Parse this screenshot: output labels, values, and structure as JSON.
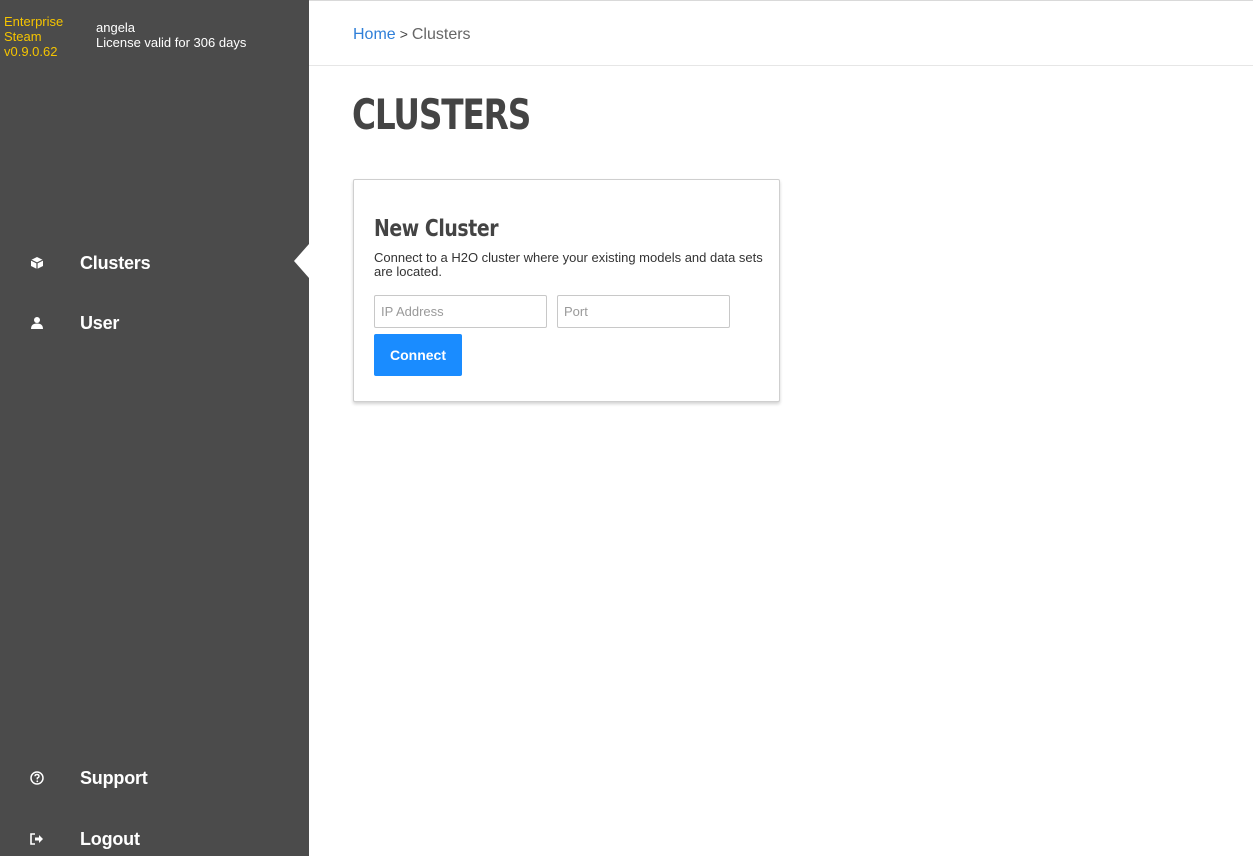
{
  "brand": {
    "line1": "Enterprise",
    "line2": "Steam",
    "version": "v0.9.0.62",
    "color": "#f5c400"
  },
  "user": {
    "name": "angela",
    "license": "License valid for 306 days"
  },
  "sidebar": {
    "items": [
      {
        "label": "Clusters",
        "icon": "cube-icon",
        "active": true
      },
      {
        "label": "User",
        "icon": "user-icon",
        "active": false
      },
      {
        "label": "Support",
        "icon": "help-circle-icon",
        "active": false
      },
      {
        "label": "Logout",
        "icon": "sign-out-icon",
        "active": false
      }
    ]
  },
  "breadcrumb": {
    "home": "Home",
    "separator": ">",
    "current": "Clusters"
  },
  "page": {
    "title": "CLUSTERS"
  },
  "card": {
    "title": "New Cluster",
    "description": "Connect to a H2O cluster where your existing models and data sets are located.",
    "ip_placeholder": "IP Address",
    "port_placeholder": "Port",
    "connect_label": "Connect"
  },
  "colors": {
    "sidebar_bg": "#4b4b4b",
    "accent": "#1a8cff",
    "link": "#2f7fd8"
  }
}
